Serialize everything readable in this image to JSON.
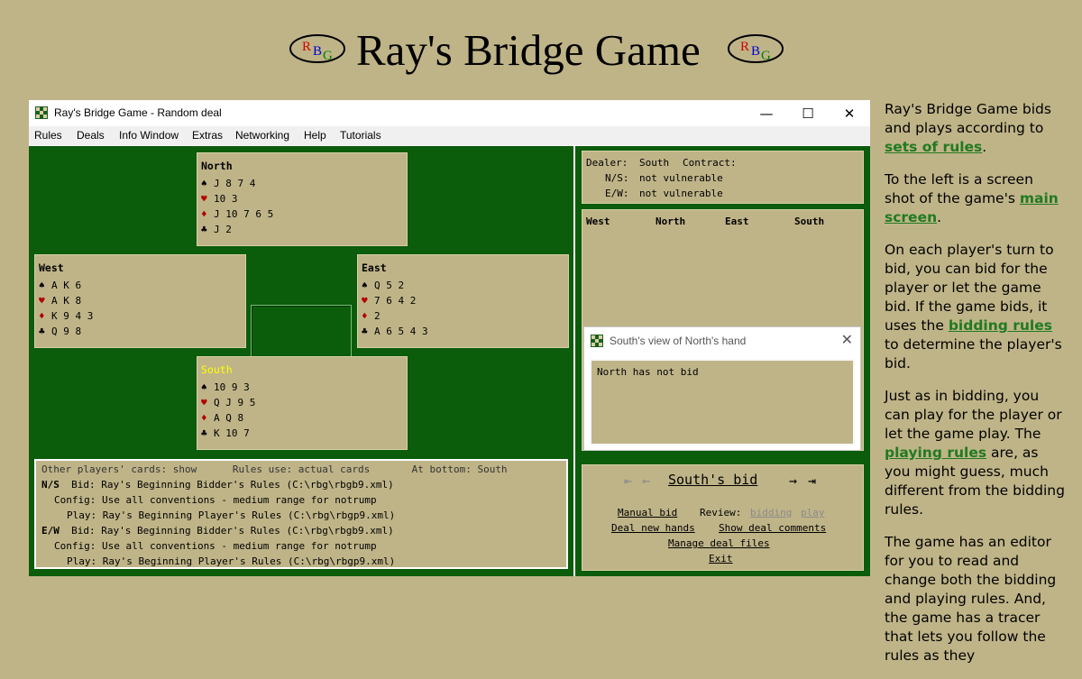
{
  "header": {
    "title": "Ray's Bridge Game",
    "logo_letters": [
      "R",
      "B",
      "G"
    ]
  },
  "window": {
    "title": "Ray's Bridge Game - Random deal",
    "minimize": "—",
    "maximize": "☐",
    "close": "✕",
    "menu": [
      "Rules",
      "Deals",
      "Info Window",
      "Extras",
      "Networking",
      "Help",
      "Tutorials"
    ]
  },
  "hands": {
    "north": {
      "name": "North",
      "spades": "J 8 7 4",
      "hearts": "10 3",
      "diamonds": "J 10 7 6 5",
      "clubs": "J 2"
    },
    "west": {
      "name": "West",
      "spades": "A K 6",
      "hearts": "A K 8",
      "diamonds": "K 9 4 3",
      "clubs": "Q 9 8"
    },
    "east": {
      "name": "East",
      "spades": "Q 5 2",
      "hearts": "7 6 4 2",
      "diamonds": "2",
      "clubs": "A 6 5 4 3"
    },
    "south": {
      "name": "South",
      "spades": "10 9 3",
      "hearts": "Q J 9 5",
      "diamonds": "A Q 8",
      "clubs": "K 10 7"
    }
  },
  "suits": {
    "spade": "♠",
    "heart": "♥",
    "diamond": "♦",
    "club": "♣"
  },
  "settings": {
    "line1": "Other players' cards: show      Rules use: actual cards       At bottom: South",
    "ns_label": "N/S",
    "ns_bid": "Bid: Ray's Beginning Bidder's Rules (C:\\rbg\\rbgb9.xml)",
    "ns_config": "Config: Use all conventions - medium range for notrump",
    "ns_play": "Play: Ray's Beginning Player's Rules (C:\\rbg\\rbgp9.xml)",
    "ew_label": "E/W",
    "ew_bid": "Bid: Ray's Beginning Bidder's Rules (C:\\rbg\\rbgb9.xml)",
    "ew_config": "Config: Use all conventions - medium range for notrump",
    "ew_play": "Play: Ray's Beginning Player's Rules (C:\\rbg\\rbgp9.xml)"
  },
  "contract": {
    "dealer_label": "Dealer:",
    "dealer": "South",
    "contract_label": "Contract:",
    "ns_label": "N/S:",
    "ns_vul": "not vulnerable",
    "ew_label": "E/W:",
    "ew_vul": "not vulnerable"
  },
  "bidding_table": {
    "columns": [
      "West",
      "North",
      "East",
      "South"
    ]
  },
  "popup": {
    "title": "South's view of North's hand",
    "message": "North has not bid"
  },
  "bid_panel": {
    "heading": "South's bid",
    "manual_bid": "Manual bid",
    "review_label": "Review:",
    "review_bidding": "bidding",
    "review_play": "play",
    "deal_new_hands": "Deal new hands",
    "show_deal_comments": "Show deal comments",
    "manage_deal_files": "Manage deal files",
    "exit": "Exit"
  },
  "side_text": {
    "p1_a": "Ray's Bridge Game bids and plays according to ",
    "p1_link": "sets of rules",
    "p1_b": ".",
    "p2_a": "To the left is a screen shot of the game's ",
    "p2_link": "main screen",
    "p2_b": ".",
    "p3_a": "On each player's turn to bid, you can bid for the player or let the game bid. If the game bids, it uses the ",
    "p3_link": "bidding rules",
    "p3_b": " to determine the player's bid.",
    "p4_a": "Just as in bidding, you can play for the player or let the game play. The ",
    "p4_link": "playing rules",
    "p4_b": " are, as you might guess, much different from the bidding rules.",
    "p5": "The game has an editor for you to read and change both the bidding and playing rules. And, the game has a tracer that lets you follow the rules as they"
  },
  "colors": {
    "felt": "#0b5c0b",
    "tan": "#bfb488",
    "link": "#217a21",
    "south_highlight": "#ffff00"
  }
}
